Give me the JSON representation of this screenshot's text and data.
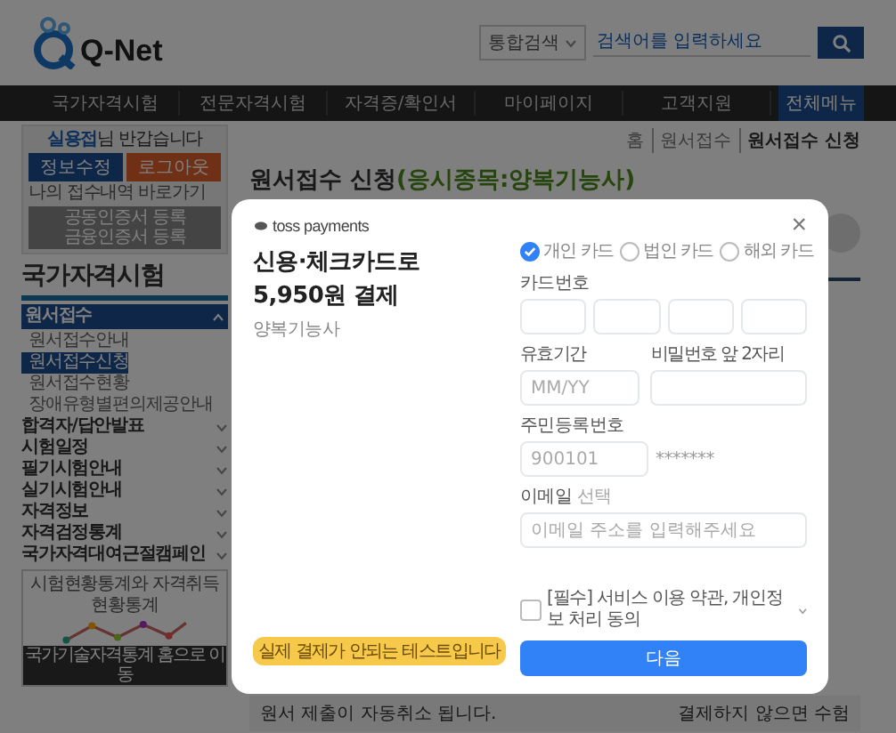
{
  "header": {
    "logo": "Q-Net",
    "search_scope": "통합검색",
    "search_placeholder": "검색어를 입력하세요"
  },
  "nav": {
    "items": [
      "국가자격시험",
      "전문자격시험",
      "자격증/확인서",
      "마이페이지",
      "고객지원"
    ],
    "all_menu": "전체메뉴"
  },
  "sidebar": {
    "user": "실용접",
    "greeting": "님 반갑습니다",
    "buttons": [
      "정보수정",
      "로그아웃"
    ],
    "receipt_link": "나의 접수내역 바로가기",
    "cert_links": [
      "공동인증서 등록",
      "금융인증서 등록"
    ],
    "section_title": "국가자격시험",
    "menu": [
      {
        "label": "원서접수",
        "expanded": true,
        "children": [
          {
            "label": "원서접수안내",
            "selected": false
          },
          {
            "label": "원서접수신청",
            "selected": true
          },
          {
            "label": "원서접수현황",
            "selected": false
          },
          {
            "label": "장애유형별편의제공안내",
            "selected": false
          }
        ]
      },
      {
        "label": "합격자/답안발표",
        "expanded": false
      },
      {
        "label": "시험일정",
        "expanded": false
      },
      {
        "label": "필기시험안내",
        "expanded": false
      },
      {
        "label": "실기시험안내",
        "expanded": false
      },
      {
        "label": "자격정보",
        "expanded": false
      },
      {
        "label": "자격검정통계",
        "expanded": false
      },
      {
        "label": "국가자격대여근절캠페인",
        "expanded": false
      }
    ],
    "stats_caption": "시험현황통계와 자격취득현황통계",
    "stats_link": "국가기술자격통계 홈으로 이동"
  },
  "main": {
    "breadcrumb": [
      "홈",
      "원서접수",
      "원서접수 신청"
    ],
    "title": "원서접수 신청",
    "title_detail": "(응시종목:양복기능사)",
    "notice": "원서 제출이 자동취소 됩니다.",
    "notice_right": "결제하지 않으면 수험"
  },
  "modal": {
    "brand": "toss payments",
    "close": "×",
    "heading": [
      "신용·체크카드로",
      "5,950원 결제"
    ],
    "item": "양복기능사",
    "card_types": [
      {
        "label": "개인 카드",
        "selected": true
      },
      {
        "label": "법인 카드",
        "selected": false
      },
      {
        "label": "해외 카드",
        "selected": false
      }
    ],
    "card_number_label": "카드번호",
    "expiry": {
      "label": "유효기간",
      "placeholder": "MM/YY"
    },
    "password": {
      "label": "비밀번호 앞 2자리"
    },
    "rrn": {
      "label": "주민등록번호",
      "placeholder": "900101",
      "masked": "*******"
    },
    "email": {
      "label": "이메일",
      "optional": "선택",
      "placeholder": "이메일 주소를 입력해주세요"
    },
    "agreement": {
      "label": "[필수] 서비스 이용 약관, 개인정보 처리 동의",
      "checked": false
    },
    "test_notice": "실제 결제가 안되는 테스트입니다",
    "next_button": "다음"
  }
}
